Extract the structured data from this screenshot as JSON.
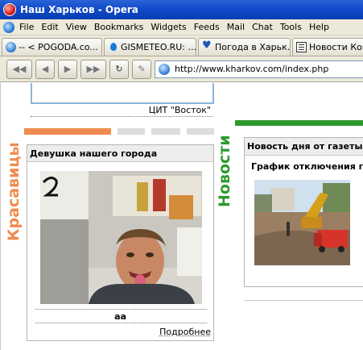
{
  "window": {
    "title": "Наш Харьков - Opera"
  },
  "menu": {
    "items": [
      "File",
      "Edit",
      "View",
      "Bookmarks",
      "Widgets",
      "Feeds",
      "Mail",
      "Chat",
      "Tools",
      "Help"
    ]
  },
  "tabs": [
    {
      "label": "-- < POGODA.co...",
      "icon": "globe-icon"
    },
    {
      "label": "GISMETEO.RU: ...",
      "icon": "drop-icon"
    },
    {
      "label": "Погода в Харьк...",
      "icon": "heart-icon"
    },
    {
      "label": "Новости Ком",
      "icon": "newspaper-icon"
    }
  ],
  "nav": {
    "rewind": "◀◀",
    "back": "◀",
    "forward": "▶",
    "fast_forward": "▶▶",
    "reload": "↻",
    "edit": "✎",
    "url": "http://www.kharkov.com/index.php"
  },
  "page": {
    "previous_caption": "ЦИТ \"Восток\"",
    "left_section_title": "Красавицы",
    "right_section_title": "Новости",
    "girl_panel": {
      "title": "Девушка нашего города",
      "photo_number": "2",
      "caption": "aa",
      "more_link": "Подробнее"
    },
    "news_panel": {
      "title": "Новость дня от газеты «Н",
      "subtitle": "График отключения г"
    }
  },
  "colors": {
    "orange_accent": "#ee8b4f",
    "green_accent": "#2e9a2e",
    "titlebar_blue": "#0d47c6"
  }
}
